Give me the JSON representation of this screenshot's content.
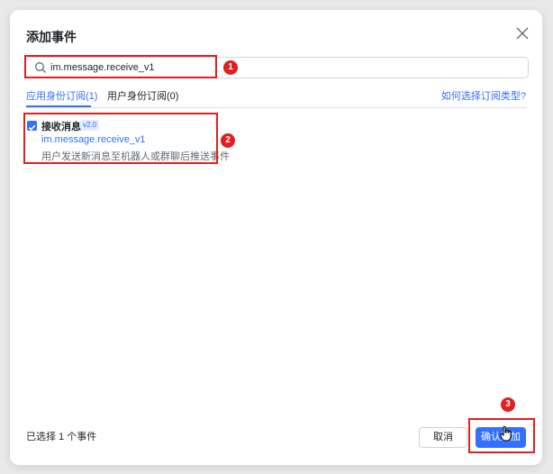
{
  "dialog": {
    "title": "添加事件",
    "close_icon": "close-icon"
  },
  "search": {
    "value": "im.message.receive_v1",
    "icon": "search-icon"
  },
  "tabs": [
    {
      "label": "应用身份订阅(1)",
      "active": true
    },
    {
      "label": "用户身份订阅(0)",
      "active": false
    }
  ],
  "help_link": "如何选择订阅类型?",
  "events": [
    {
      "name": "接收消息",
      "version": "v2.0",
      "key": "im.message.receive_v1",
      "description": "用户发送新消息至机器人或群聊后推送事件",
      "checked": true
    }
  ],
  "footer": {
    "selected_count": "已选择 1 个事件",
    "cancel_label": "取消",
    "confirm_label": "确认添加"
  },
  "annotations": [
    "1",
    "2",
    "3"
  ],
  "colors": {
    "accent": "#3370ff",
    "annotation": "#e02020"
  }
}
